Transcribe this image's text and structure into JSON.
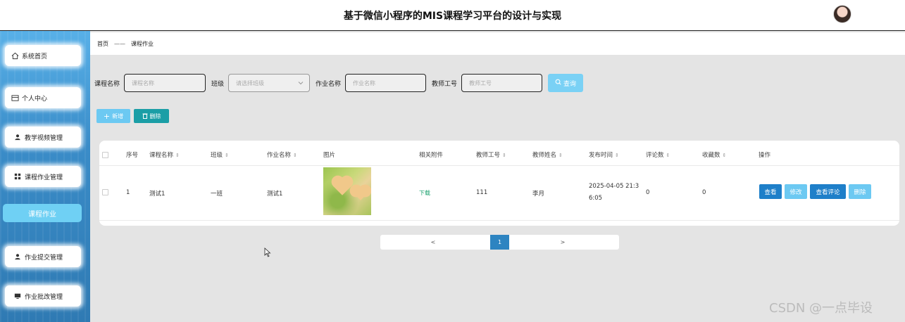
{
  "header": {
    "title": "基于微信小程序的MIS课程学习平台的设计与实现"
  },
  "sidebar": {
    "items": [
      {
        "label": "系统首页"
      },
      {
        "label": "个人中心"
      },
      {
        "label": "教学视频管理"
      },
      {
        "label": "课程作业管理"
      },
      {
        "label": "课程作业"
      },
      {
        "label": "作业提交管理"
      },
      {
        "label": "作业批改管理"
      }
    ]
  },
  "breadcrumb": {
    "home": "首页",
    "separator": "——",
    "current": "课程作业"
  },
  "filters": {
    "course_label": "课程名称",
    "course_placeholder": "课程名称",
    "class_label": "班级",
    "class_placeholder": "请选择班级",
    "homework_label": "作业名称",
    "homework_placeholder": "作业名称",
    "teacher_id_label": "教师工号",
    "teacher_id_placeholder": "教师工号",
    "search_label": "查询"
  },
  "toolbar": {
    "add_label": "新增",
    "delete_label": "删除"
  },
  "table": {
    "headers": {
      "index": "序号",
      "course": "课程名称",
      "class": "班级",
      "homework": "作业名称",
      "image": "图片",
      "attachment": "相关附件",
      "teacher_id": "教师工号",
      "teacher_name": "教师姓名",
      "publish_time": "发布时间",
      "comments": "评论数",
      "favorites": "收藏数",
      "ops": "操作"
    },
    "row": {
      "index": "1",
      "course": "测试1",
      "class": "一班",
      "homework": "测试1",
      "attachment": "下载",
      "teacher_id": "111",
      "teacher_name": "李月",
      "publish_time_1": "2025-04-05 21:3",
      "publish_time_2": "6:05",
      "comments": "0",
      "favorites": "0",
      "ops": {
        "view": "查看",
        "edit": "修改",
        "view_comments": "查看评论",
        "delete": "删除"
      }
    }
  },
  "pagination": {
    "prev": "<",
    "current": "1",
    "next": ">"
  },
  "watermark": "CSDN @一点毕设",
  "colors": {
    "sidebar": "#3a8cc8",
    "primary": "#1e7fc9",
    "light": "#6cc9f2",
    "teal": "#1b9ea6"
  }
}
